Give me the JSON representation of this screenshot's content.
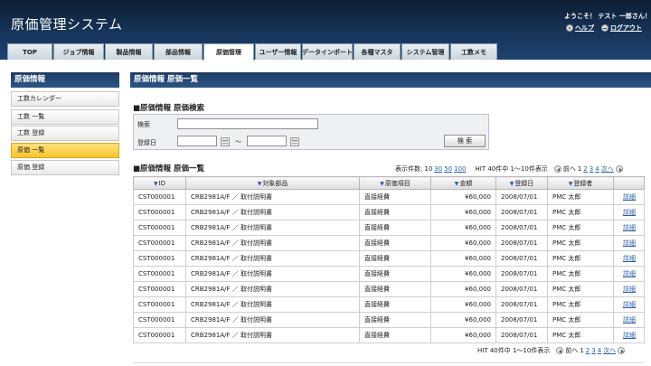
{
  "app_title": "原価管理システム",
  "header": {
    "welcome": "ようこそ！ テスト 一郎さん！",
    "help": "ヘルプ",
    "logout": "ログアウト"
  },
  "tabs": [
    "TOP",
    "ジョブ情報",
    "製品情報",
    "部品情報",
    "原価管理",
    "ユーザー情報",
    "データインポート",
    "各種マスタ",
    "システム管理",
    "工数メモ"
  ],
  "active_tab": "原価管理",
  "sidebar": {
    "title": "原価情報",
    "items": [
      "工数カレンダー",
      "工数 一覧",
      "工数 登録",
      "原価 一覧",
      "原価 登録"
    ],
    "active": "原価 一覧"
  },
  "page_title": "原価情報 原価一覧",
  "search": {
    "section_title": "■原価情報 原価検索",
    "keyword_label": "検索",
    "keyword_value": "",
    "date_label": "登録日",
    "date_from": "",
    "date_to": "",
    "tilde": "〜",
    "button": "検 索"
  },
  "list": {
    "section_title": "■原価情報 原価一覧",
    "display_count_label": "表示件数:",
    "display_counts": [
      "10",
      "30",
      "50",
      "100"
    ],
    "hit_text": "HIT 40件中 1〜10件表示",
    "prev": "前へ",
    "next": "次へ",
    "pages": [
      "1",
      "2",
      "3",
      "4"
    ],
    "columns": [
      "ID",
      "対象部品",
      "原価項目",
      "金額",
      "登録日",
      "登録者",
      ""
    ],
    "rows": [
      {
        "id": "CST000001",
        "part": "CRB2981A/F ／ 取付説明書",
        "item": "直接経費",
        "amount": "¥60,000",
        "date": "2008/07/01",
        "user": "PMC 太郎",
        "action": "詳細"
      },
      {
        "id": "CST000001",
        "part": "CRB2981A/F ／ 取付説明書",
        "item": "直接経費",
        "amount": "¥60,000",
        "date": "2008/07/01",
        "user": "PMC 太郎",
        "action": "詳細"
      },
      {
        "id": "CST000001",
        "part": "CRB2981A/F ／ 取付説明書",
        "item": "直接経費",
        "amount": "¥60,000",
        "date": "2008/07/01",
        "user": "PMC 太郎",
        "action": "詳細"
      },
      {
        "id": "CST000001",
        "part": "CRB2981A/F ／ 取付説明書",
        "item": "直接経費",
        "amount": "¥60,000",
        "date": "2008/07/01",
        "user": "PMC 太郎",
        "action": "詳細"
      },
      {
        "id": "CST000001",
        "part": "CRB2981A/F ／ 取付説明書",
        "item": "直接経費",
        "amount": "¥60,000",
        "date": "2008/07/01",
        "user": "PMC 太郎",
        "action": "詳細"
      },
      {
        "id": "CST000001",
        "part": "CRB2981A/F ／ 取付説明書",
        "item": "直接経費",
        "amount": "¥60,000",
        "date": "2008/07/01",
        "user": "PMC 太郎",
        "action": "詳細"
      },
      {
        "id": "CST000001",
        "part": "CRB2981A/F ／ 取付説明書",
        "item": "直接経費",
        "amount": "¥60,000",
        "date": "2008/07/01",
        "user": "PMC 太郎",
        "action": "詳細"
      },
      {
        "id": "CST000001",
        "part": "CRB2981A/F ／ 取付説明書",
        "item": "直接経費",
        "amount": "¥60,000",
        "date": "2008/07/01",
        "user": "PMC 太郎",
        "action": "詳細"
      },
      {
        "id": "CST000001",
        "part": "CRB2981A/F ／ 取付説明書",
        "item": "直接経費",
        "amount": "¥60,000",
        "date": "2008/07/01",
        "user": "PMC 太郎",
        "action": "詳細"
      },
      {
        "id": "CST000001",
        "part": "CRB2981A/F ／ 取付説明書",
        "item": "直接経費",
        "amount": "¥60,000",
        "date": "2008/07/01",
        "user": "PMC 太郎",
        "action": "詳細"
      }
    ]
  },
  "colors": {
    "header_bg": "#17345a",
    "panel_head": "#2c5686",
    "active_side": "#f7c52e",
    "link": "#2a5da8"
  }
}
